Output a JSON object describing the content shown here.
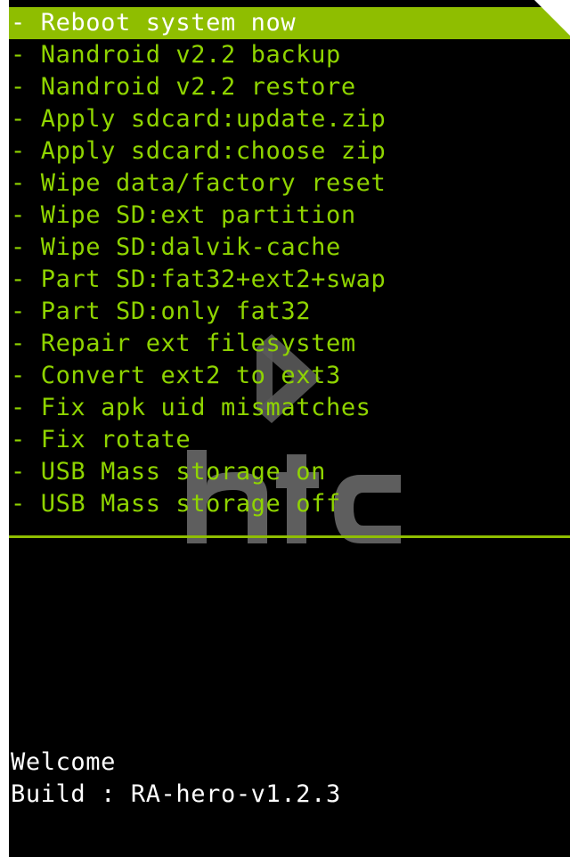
{
  "theme": {
    "accent": "#8fbe00",
    "menu_text": "#8fd400",
    "selected_text": "#ffffff",
    "log_text": "#ffffff",
    "background": "#000000"
  },
  "menu": {
    "items": [
      {
        "label": "- Reboot system now"
      },
      {
        "label": "- Nandroid v2.2 backup"
      },
      {
        "label": "- Nandroid v2.2 restore"
      },
      {
        "label": "- Apply sdcard:update.zip"
      },
      {
        "label": "- Apply sdcard:choose zip"
      },
      {
        "label": "- Wipe data/factory reset"
      },
      {
        "label": "- Wipe SD:ext partition"
      },
      {
        "label": "- Wipe SD:dalvik-cache"
      },
      {
        "label": "- Part SD:fat32+ext2+swap"
      },
      {
        "label": "- Part SD:only fat32"
      },
      {
        "label": "- Repair ext filesystem"
      },
      {
        "label": "- Convert ext2 to ext3"
      },
      {
        "label": "- Fix apk uid mismatches"
      },
      {
        "label": "- Fix rotate"
      },
      {
        "label": "- USB Mass storage on"
      },
      {
        "label": "- USB Mass storage off"
      }
    ],
    "selected_index": 0
  },
  "log": {
    "lines": [
      "Welcome",
      "Build : RA-hero-v1.2.3"
    ]
  },
  "background_logo": {
    "icon": "htc-logo-icon"
  }
}
